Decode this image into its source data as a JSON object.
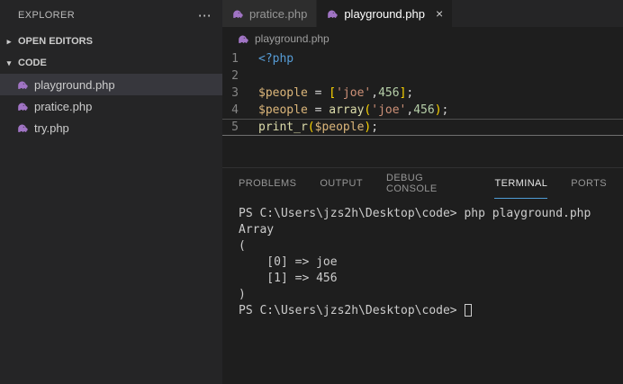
{
  "explorer": {
    "title": "EXPLORER",
    "more_actions_label": "⋯",
    "open_editors": {
      "label": "OPEN EDITORS",
      "chevron": "▸"
    },
    "code_section": {
      "label": "CODE",
      "chevron": "▾"
    },
    "files": [
      {
        "name": "playground.php",
        "selected": true
      },
      {
        "name": "pratice.php",
        "selected": false
      },
      {
        "name": "try.php",
        "selected": false
      }
    ]
  },
  "editor_tabs": [
    {
      "label": "pratice.php",
      "active": false
    },
    {
      "label": "playground.php",
      "active": true,
      "close_label": "×"
    }
  ],
  "breadcrumb": {
    "file": "playground.php"
  },
  "editor": {
    "lines": [
      {
        "num": "1",
        "current": false,
        "tokens": [
          {
            "t": "<?php",
            "s": "keyword"
          }
        ]
      },
      {
        "num": "2",
        "current": false,
        "tokens": []
      },
      {
        "num": "3",
        "current": false,
        "tokens": [
          {
            "t": "$people",
            "s": "variable"
          },
          {
            "t": " = ",
            "s": "punctuation"
          },
          {
            "t": "[",
            "s": "bracket"
          },
          {
            "t": "'joe'",
            "s": "string"
          },
          {
            "t": ",",
            "s": "punctuation"
          },
          {
            "t": "456",
            "s": "number"
          },
          {
            "t": "]",
            "s": "bracket"
          },
          {
            "t": ";",
            "s": "punctuation"
          }
        ]
      },
      {
        "num": "4",
        "current": false,
        "tokens": [
          {
            "t": "$people",
            "s": "variable"
          },
          {
            "t": " = ",
            "s": "punctuation"
          },
          {
            "t": "array",
            "s": "function"
          },
          {
            "t": "(",
            "s": "bracket"
          },
          {
            "t": "'joe'",
            "s": "string"
          },
          {
            "t": ",",
            "s": "punctuation"
          },
          {
            "t": "456",
            "s": "number"
          },
          {
            "t": ")",
            "s": "bracket"
          },
          {
            "t": ";",
            "s": "punctuation"
          }
        ]
      },
      {
        "num": "5",
        "current": true,
        "tokens": [
          {
            "t": "print_r",
            "s": "function"
          },
          {
            "t": "(",
            "s": "bracket"
          },
          {
            "t": "$people",
            "s": "variable"
          },
          {
            "t": ")",
            "s": "bracket"
          },
          {
            "t": ";",
            "s": "punctuation"
          }
        ]
      }
    ]
  },
  "panel": {
    "tabs": [
      {
        "label": "PROBLEMS",
        "active": false
      },
      {
        "label": "OUTPUT",
        "active": false
      },
      {
        "label": "DEBUG CONSOLE",
        "active": false
      },
      {
        "label": "TERMINAL",
        "active": true
      },
      {
        "label": "PORTS",
        "active": false
      }
    ],
    "terminal": {
      "lines": [
        "PS C:\\Users\\jzs2h\\Desktop\\code> php playground.php",
        "Array",
        "(",
        "    [0] => joe",
        "    [1] => 456",
        ")",
        "PS C:\\Users\\jzs2h\\Desktop\\code> "
      ]
    }
  },
  "colors": {
    "keyword": "#569cd6",
    "variable": "#dcb67a",
    "string": "#ce9178",
    "number": "#b5cea8",
    "function": "#dcdcaa",
    "punctuation": "#d4d4d4",
    "bracket": "#ffd700",
    "php_icon": "#a074c4",
    "panel_active_underline": "#4f9cd6",
    "selected_file_bg": "#37373d"
  }
}
